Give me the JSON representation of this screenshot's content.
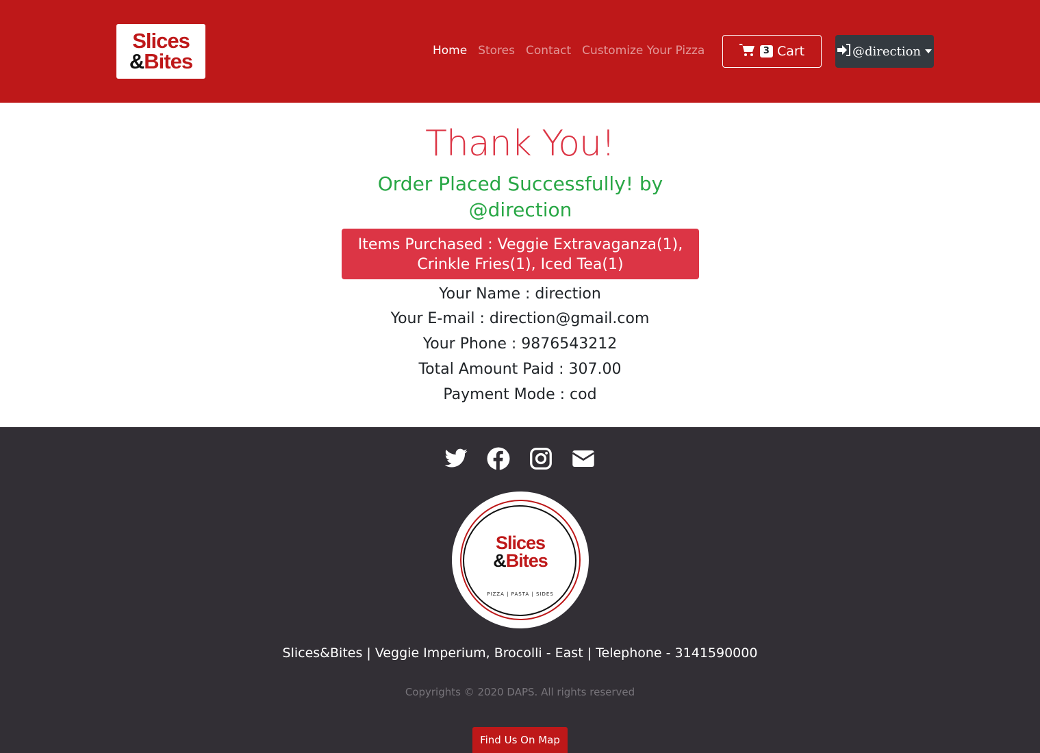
{
  "header": {
    "logo": {
      "line1": "Slices",
      "amp": "&",
      "line2": "Bites"
    },
    "nav": [
      "Home",
      "Stores",
      "Contact",
      "Customize Your Pizza"
    ],
    "cart": {
      "count": "3",
      "label": "Cart"
    },
    "user": {
      "label": "@direction"
    }
  },
  "main": {
    "title": "Thank You!",
    "success": "Order Placed Successfully! by @direction",
    "items": "Items Purchased : Veggie Extravaganza(1), Crinkle Fries(1), Iced Tea(1)",
    "name": "Your Name : direction",
    "email": "Your E-mail : direction@gmail.com",
    "phone": "Your Phone : 9876543212",
    "total": "Total Amount Paid : 307.00",
    "payment": "Payment Mode : cod"
  },
  "footer": {
    "social_icons": [
      "twitter-icon",
      "facebook-icon",
      "instagram-icon",
      "envelope-icon"
    ],
    "logo": {
      "line1": "Slices",
      "amp": "&",
      "line2": "Bites",
      "tagline": "PIZZA | PASTA | SIDES"
    },
    "address": "Slices&Bites | Veggie Imperium, Brocolli - East | Telephone - 3141590000",
    "copyright": "Copyrights © 2020 DAPS. All rights reserved",
    "map_button": "Find Us On Map"
  },
  "colors": {
    "brand_red": "#be1819",
    "danger": "#dc3545",
    "success": "#28a745",
    "footer_bg": "#322f35",
    "dark_button": "#343a40"
  }
}
